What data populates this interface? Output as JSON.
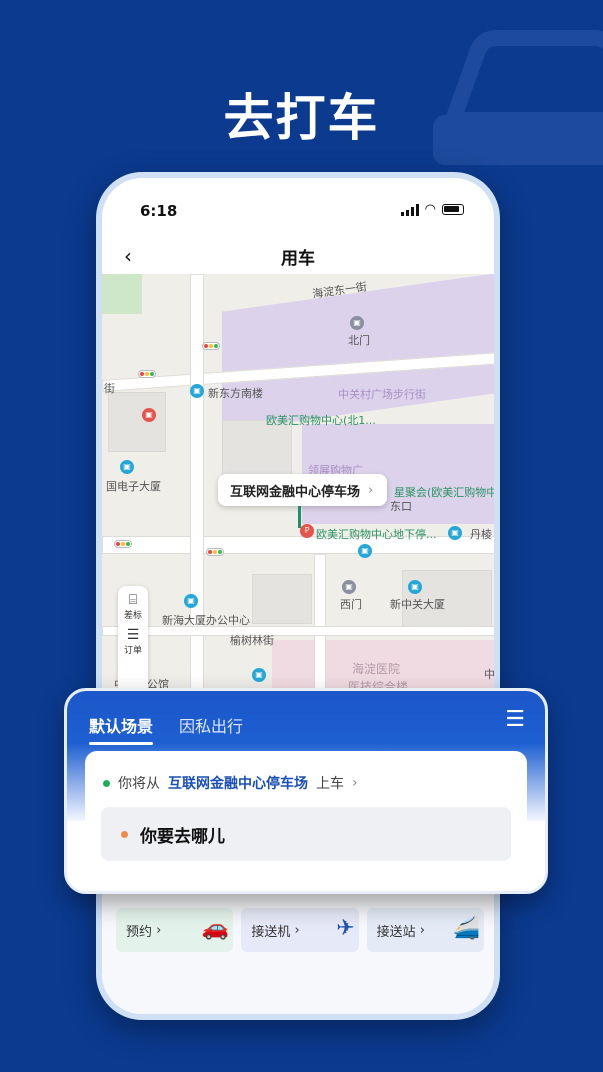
{
  "headline": "去打车",
  "status_bar": {
    "time": "6:18"
  },
  "nav": {
    "back_icon": "chevron-left-icon",
    "title": "用车"
  },
  "map": {
    "labels": {
      "yihedong": "海淀东一街",
      "beimen": "北门",
      "zhongguancun_plaza": "中关村广场步行街",
      "xindongfang": "新东方南楼",
      "jie": "街",
      "oumei_north": "欧美汇购物中心(北1...",
      "guodianzi": "国电子大厦",
      "lingzhan": "领展购物广",
      "xingjuhui": "星聚会(欧美汇购物中",
      "dongkou": "东口",
      "danleng": "丹棱",
      "oumei_parking": "欧美汇购物中心地下停...",
      "xinhaida": "新海大厦办公中心",
      "ximen": "西门",
      "xinzhongguancun": "新中关大厦",
      "yushulin": "榆树林街",
      "zhongguancun_park": "中关村公馆",
      "haidian_hospital": "海淀医院",
      "hospital_building": "医技综合楼",
      "zhong": "中"
    },
    "pickup_label": "互联网金融中心停车场",
    "tools": [
      {
        "icon": "briefcase-icon",
        "label": "差标"
      },
      {
        "icon": "order-icon",
        "label": "订单"
      }
    ]
  },
  "panel": {
    "tabs": [
      "默认场景",
      "因私出行"
    ],
    "active_tab": 0,
    "menu_icon": "menu-icon",
    "from_prefix": "你将从",
    "from_place": "互联网金融中心停车场",
    "from_suffix": "上车",
    "to_placeholder": "你要去哪儿",
    "colors": {
      "accent": "#1c57c9",
      "from_dot": "#1fae5d",
      "to_dot": "#f28a4a"
    }
  },
  "quick_actions": [
    {
      "label": "预约",
      "icon": "car-icon"
    },
    {
      "label": "接送机",
      "icon": "airplane-icon"
    },
    {
      "label": "接送站",
      "icon": "train-icon"
    }
  ]
}
